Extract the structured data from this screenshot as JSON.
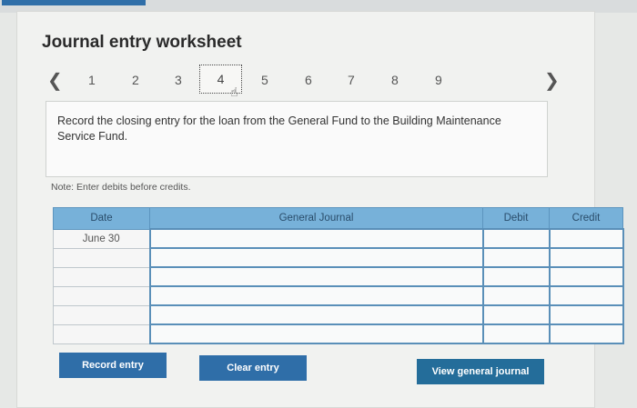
{
  "title": "Journal entry worksheet",
  "pager": {
    "prev_icon": "chevron-left",
    "next_icon": "chevron-right",
    "pages": [
      "1",
      "2",
      "3",
      "4",
      "5",
      "6",
      "7",
      "8",
      "9"
    ],
    "current_page": "4"
  },
  "prompt": "Record the closing entry for the loan from the General Fund to the Building Maintenance Service Fund.",
  "note": "Note: Enter debits before credits.",
  "table": {
    "headers": {
      "date": "Date",
      "journal": "General Journal",
      "debit": "Debit",
      "credit": "Credit"
    },
    "rows": [
      {
        "date": "June 30",
        "journal": "",
        "debit": "",
        "credit": ""
      },
      {
        "date": "",
        "journal": "",
        "debit": "",
        "credit": ""
      },
      {
        "date": "",
        "journal": "",
        "debit": "",
        "credit": ""
      },
      {
        "date": "",
        "journal": "",
        "debit": "",
        "credit": ""
      },
      {
        "date": "",
        "journal": "",
        "debit": "",
        "credit": ""
      },
      {
        "date": "",
        "journal": "",
        "debit": "",
        "credit": ""
      }
    ]
  },
  "buttons": {
    "record": "Record entry",
    "clear": "Clear entry",
    "view": "View general journal"
  },
  "colors": {
    "accent": "#2f6ea8",
    "header": "#77b1d9"
  }
}
